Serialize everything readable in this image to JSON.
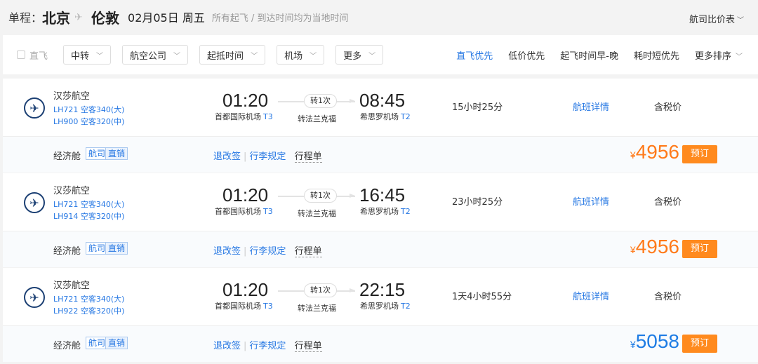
{
  "header": {
    "trip_label": "单程：",
    "from_city": "北京",
    "to_city": "伦敦",
    "date": "02月05日 周五",
    "note": "所有起飞 / 到达时间均为当地时间",
    "compare": "航司比价表"
  },
  "filters": {
    "direct_label": "直飞",
    "dropdowns": [
      "中转",
      "航空公司",
      "起抵时间",
      "机场",
      "更多"
    ],
    "sorts": [
      "直飞优先",
      "低价优先",
      "起飞时间早-晚",
      "耗时短优先",
      "更多排序"
    ]
  },
  "flights": [
    {
      "airline": "汉莎航空",
      "flight1": "LH721 空客340(大)",
      "flight2": "LH900 空客320(中)",
      "dep_time": "01:20",
      "dep_airport": "首都国际机场",
      "dep_terminal": "T3",
      "stop_badge": "转1次",
      "stop_city": "转法兰克福",
      "arr_time": "08:45",
      "arr_airport": "希思罗机场",
      "arr_terminal": "T2",
      "duration": "15小时25分",
      "details": "航班详情",
      "tax": "含税价",
      "cabin": "经济舱",
      "tag1": "航司",
      "tag2": "直销",
      "link1": "退改签",
      "link2": "行李规定",
      "link3": "行程单",
      "currency": "¥",
      "price": "4956",
      "book": "预订"
    },
    {
      "airline": "汉莎航空",
      "flight1": "LH721 空客340(大)",
      "flight2": "LH914 空客320(中)",
      "dep_time": "01:20",
      "dep_airport": "首都国际机场",
      "dep_terminal": "T3",
      "stop_badge": "转1次",
      "stop_city": "转法兰克福",
      "arr_time": "16:45",
      "arr_airport": "希思罗机场",
      "arr_terminal": "T2",
      "duration": "23小时25分",
      "details": "航班详情",
      "tax": "含税价",
      "cabin": "经济舱",
      "tag1": "航司",
      "tag2": "直销",
      "link1": "退改签",
      "link2": "行李规定",
      "link3": "行程单",
      "currency": "¥",
      "price": "4956",
      "book": "预订"
    },
    {
      "airline": "汉莎航空",
      "flight1": "LH721 空客340(大)",
      "flight2": "LH922 空客320(中)",
      "dep_time": "01:20",
      "dep_airport": "首都国际机场",
      "dep_terminal": "T3",
      "stop_badge": "转1次",
      "stop_city": "转法兰克福",
      "arr_time": "22:15",
      "arr_airport": "希思罗机场",
      "arr_terminal": "T2",
      "duration": "1天4小时55分",
      "details": "航班详情",
      "tax": "含税价",
      "cabin": "经济舱",
      "tag1": "航司",
      "tag2": "直销",
      "link1": "退改签",
      "link2": "行李规定",
      "link3": "行程单",
      "currency": "¥",
      "price": "5058",
      "book": "预订"
    }
  ],
  "colors": {
    "accent_blue": "#2577e3",
    "price_orange": "#ff7a1a",
    "price_blue": "#1e7ce4",
    "book_orange": "#ff8a1e"
  },
  "icons": {
    "airline_logo": "lufthansa-crane-icon",
    "dropdown": "chevron-down-icon"
  }
}
